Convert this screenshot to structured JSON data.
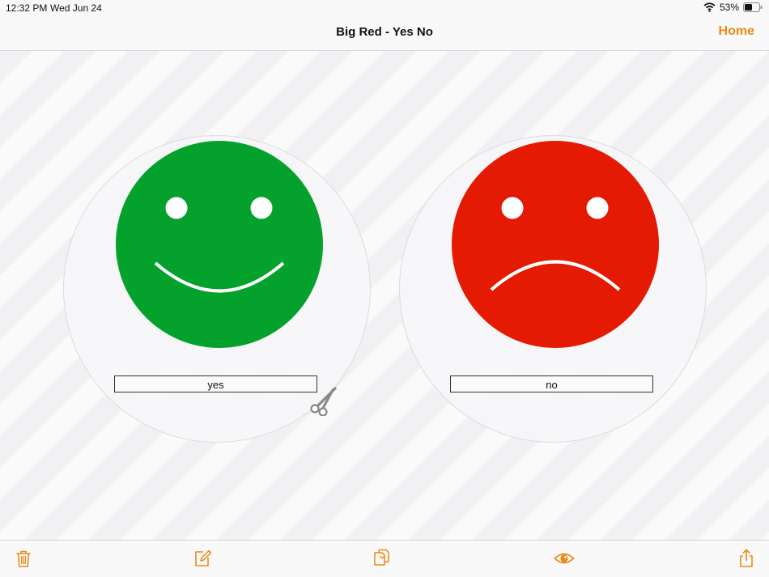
{
  "status": {
    "time": "12:32 PM",
    "date": "Wed Jun 24",
    "battery": "53%",
    "wifi_icon": "wifi-icon",
    "battery_icon": "battery-icon"
  },
  "nav": {
    "title": "Big Red - Yes No",
    "home_label": "Home"
  },
  "cards": [
    {
      "label": "yes",
      "face": "happy",
      "color": "#04a22d"
    },
    {
      "label": "no",
      "face": "sad",
      "color": "#e51a02"
    }
  ],
  "overlay_icon": "scissors-icon",
  "toolbar": {
    "accent": "#e98a16",
    "icons": [
      "trash-icon",
      "edit-icon",
      "copy-icon",
      "eye-icon",
      "share-icon"
    ]
  }
}
